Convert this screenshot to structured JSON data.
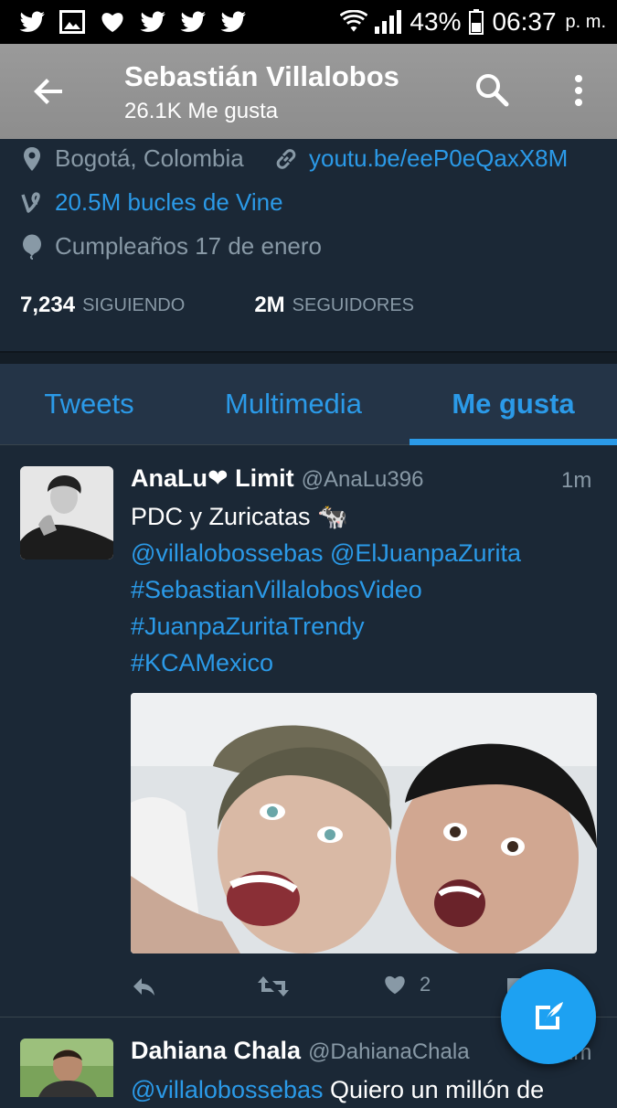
{
  "status_bar": {
    "battery": "43%",
    "time": "06:37",
    "ampm": "p. m.",
    "left_icons": [
      "twitter-icon",
      "gallery-icon",
      "heart-icon",
      "twitter-icon",
      "twitter-icon",
      "twitter-icon"
    ]
  },
  "app_bar": {
    "title": "Sebastián Villalobos",
    "subtitle": "26.1K Me gusta"
  },
  "profile": {
    "location": "Bogotá, Colombia",
    "website": "youtu.be/eeP0eQaxX8M",
    "vine": "20.5M bucles de Vine",
    "birthday": "Cumpleaños 17 de enero",
    "following_count": "7,234",
    "following_label": "SIGUIENDO",
    "followers_count": "2M",
    "followers_label": "SEGUIDORES"
  },
  "tabs": [
    {
      "label": "Tweets",
      "active": false
    },
    {
      "label": "Multimedia",
      "active": false
    },
    {
      "label": "Me gusta",
      "active": true
    }
  ],
  "tweets": [
    {
      "name": "AnaLu❤ Limit",
      "handle": "@AnaLu396",
      "time": "1m",
      "line1": "PDC y Zuricatas 🐄",
      "mentions": "@villalobossebas @ElJuanpaZurita",
      "tag1": "#SebastianVillalobosVideo",
      "tag2": "#JuanpaZuritaTrendy",
      "tag3": "#KCAMexico",
      "likes": "2"
    },
    {
      "name": "Dahiana Chala",
      "handle": "@DahianaChala",
      "time": "1m",
      "mention": "@villalobossebas",
      "text": " Quiero un millón de"
    }
  ],
  "colors": {
    "background": "#1b2836",
    "accent": "#2b9ae8",
    "secondary_text": "#8899a6"
  }
}
